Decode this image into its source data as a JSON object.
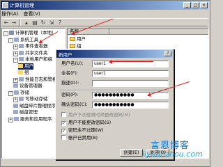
{
  "window": {
    "title": "计算机管理"
  },
  "menu": [
    "操作(A)",
    "查看(V)"
  ],
  "tree": [
    {
      "label": "计算机管理（本地）",
      "indent": 0,
      "toggle": "-"
    },
    {
      "label": "系统工具",
      "indent": 1,
      "toggle": "-"
    },
    {
      "label": "事件查看器",
      "indent": 2,
      "toggle": "+"
    },
    {
      "label": "共享文件夹",
      "indent": 2,
      "toggle": "+"
    },
    {
      "label": "本地用户和组",
      "indent": 2,
      "toggle": "-"
    },
    {
      "label": "用户",
      "indent": 3,
      "selected": true
    },
    {
      "label": "组",
      "indent": 3
    },
    {
      "label": "性能日志和警报",
      "indent": 2,
      "toggle": "+"
    },
    {
      "label": "设备管理器",
      "indent": 2
    },
    {
      "label": "存储",
      "indent": 1,
      "toggle": "-"
    },
    {
      "label": "可移动存储",
      "indent": 2,
      "toggle": "+"
    },
    {
      "label": "磁盘碎片整理程序",
      "indent": 2
    },
    {
      "label": "磁盘管理",
      "indent": 2
    },
    {
      "label": "服务和应用程序",
      "indent": 1,
      "toggle": "+"
    }
  ],
  "list": {
    "header": "名称",
    "items": [
      "用户",
      "组"
    ]
  },
  "dialog": {
    "title": "新用户",
    "username_label": "用户名(U):",
    "username_value": "user1",
    "fullname_label": "全名(F):",
    "fullname_value": "user1",
    "description_label": "描述(D):",
    "description_value": "",
    "password_label": "密码(P):",
    "password_value": "●●●●●●●●●●●",
    "confirm_label": "确认密码(C):",
    "confirm_value": "●●●●●●●●●●●",
    "checks": [
      {
        "label": "用户下次登录时须更改密码(M)",
        "checked": false,
        "disabled": true
      },
      {
        "label": "用户不能更改密码(S)",
        "checked": true
      },
      {
        "label": "密码永不过期(W)",
        "checked": true
      },
      {
        "label": "帐户已禁用(B)",
        "checked": false
      }
    ],
    "create_label": "创建(E)",
    "close_label": "关闭(O)"
  },
  "watermark": {
    "line1": "言恩博客",
    "line2": "liyuanzhou.com"
  }
}
